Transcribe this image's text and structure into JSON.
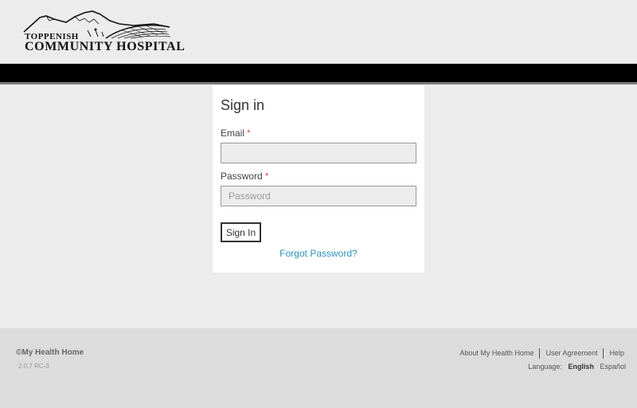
{
  "logo": {
    "line1": "TOPPENISH",
    "line2": "COMMUNITY HOSPITAL"
  },
  "signin": {
    "title": "Sign in",
    "email_label": "Email",
    "email_value": "",
    "email_placeholder": "",
    "password_label": "Password",
    "password_placeholder": "Password",
    "required_mark": "*",
    "button_label": "Sign In",
    "forgot_label": "Forgot Password?"
  },
  "footer": {
    "copyright": "©My Health Home",
    "version": "2.0.7 RC-3",
    "links": [
      "About My Health Home",
      "User Agreement",
      "Help"
    ],
    "language_label": "Language:",
    "languages": [
      {
        "label": "English",
        "active": true
      },
      {
        "label": "Español",
        "active": false
      }
    ]
  },
  "colors": {
    "background": "#ececec",
    "header_bar": "#000000",
    "link": "#2a8fbd",
    "required": "#d9534f"
  }
}
